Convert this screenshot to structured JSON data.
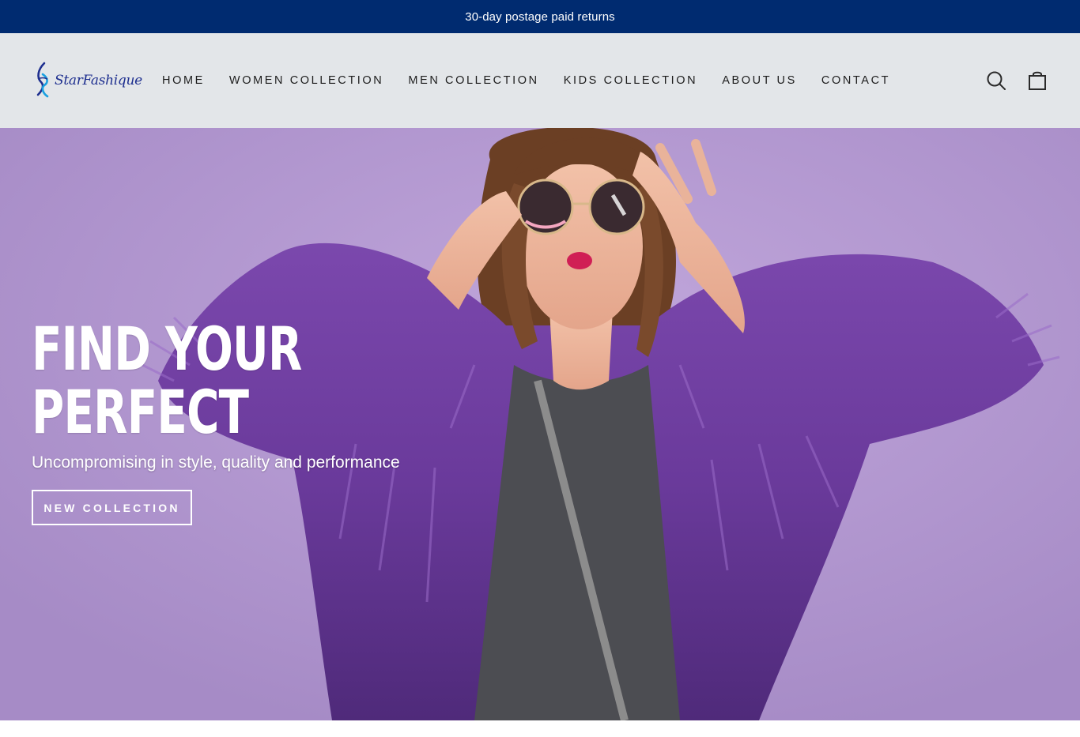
{
  "announcement": {
    "text": "30-day postage paid returns"
  },
  "header": {
    "logo_text": "StarFashique",
    "nav": [
      {
        "label": "HOME"
      },
      {
        "label": "WOMEN COLLECTION"
      },
      {
        "label": "MEN COLLECTION"
      },
      {
        "label": "KIDS COLLECTION"
      },
      {
        "label": "ABOUT US"
      },
      {
        "label": "CONTACT"
      }
    ],
    "icons": {
      "search": "search-icon",
      "cart": "shopping-bag-icon"
    }
  },
  "hero": {
    "title_line1": "FIND YOUR",
    "title_line2": "PERFECT",
    "subtitle": "Uncompromising in style, quality and performance",
    "button_label": "NEW COLLECTION"
  },
  "colors": {
    "announcement_bg": "#002b70",
    "header_bg": "#e3e6e9",
    "hero_bg": "#b59ad2",
    "coat_purple": "#6b3a9c",
    "text_dark": "#1d1d1d"
  }
}
